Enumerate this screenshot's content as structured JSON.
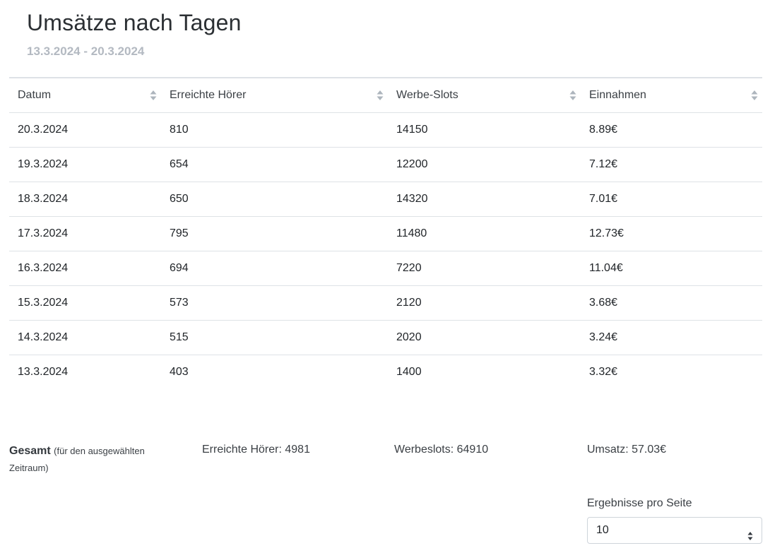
{
  "header": {
    "title": "Umsätze nach Tagen",
    "subtitle": "13.3.2024 - 20.3.2024"
  },
  "table": {
    "columns": [
      "Datum",
      "Erreichte Hörer",
      "Werbe-Slots",
      "Einnahmen"
    ],
    "rows": [
      [
        "20.3.2024",
        "810",
        "14150",
        "8.89€"
      ],
      [
        "19.3.2024",
        "654",
        "12200",
        "7.12€"
      ],
      [
        "18.3.2024",
        "650",
        "14320",
        "7.01€"
      ],
      [
        "17.3.2024",
        "795",
        "11480",
        "12.73€"
      ],
      [
        "16.3.2024",
        "694",
        "7220",
        "11.04€"
      ],
      [
        "15.3.2024",
        "573",
        "2120",
        "3.68€"
      ],
      [
        "14.3.2024",
        "515",
        "2020",
        "3.24€"
      ],
      [
        "13.3.2024",
        "403",
        "1400",
        "3.32€"
      ]
    ]
  },
  "totals": {
    "label": "Gesamt",
    "note": "(für den ausgewählten Zeitraum)",
    "listeners": "Erreichte Hörer: 4981",
    "slots": "Werbeslots: 64910",
    "revenue": "Umsatz: 57.03€"
  },
  "pagination": {
    "label": "Ergebnisse pro Seite",
    "selected": "10"
  },
  "icons": {
    "sort": "sort-arrows-icon",
    "select": "select-arrows-icon"
  },
  "colors": {
    "subtitle": "#b3b9c1",
    "border": "#dee2e6",
    "sort_icon": "#adb5bd"
  }
}
